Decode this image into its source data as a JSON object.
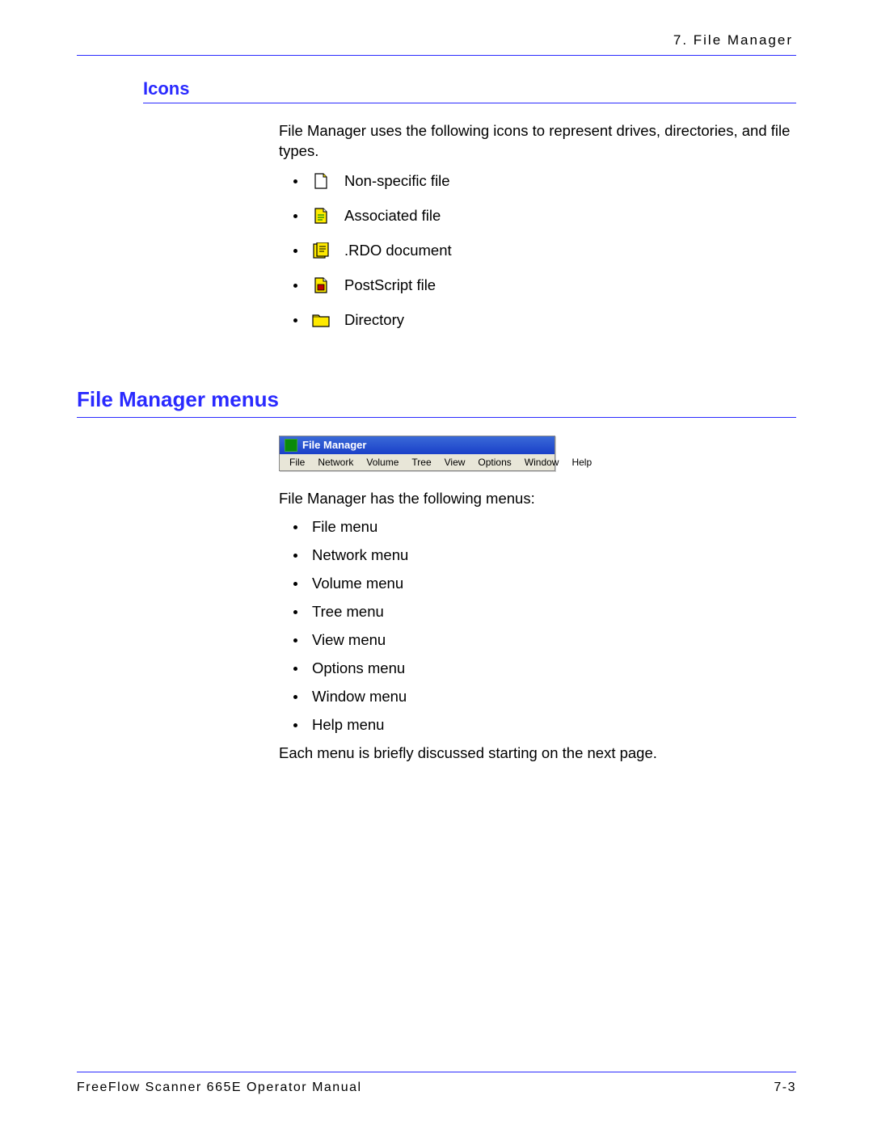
{
  "chapter_header": "7. File Manager",
  "section_icons": {
    "heading": "Icons",
    "intro": "File Manager uses the following icons to represent drives, directories, and file types.",
    "items": [
      {
        "label": "Non-specific file"
      },
      {
        "label": "Associated file"
      },
      {
        "label": ".RDO document"
      },
      {
        "label": "PostScript file"
      },
      {
        "label": "Directory"
      }
    ]
  },
  "section_menus": {
    "heading": "File Manager menus",
    "window_title": "File Manager",
    "menubar": [
      "File",
      "Network",
      "Volume",
      "Tree",
      "View",
      "Options",
      "Window",
      "Help"
    ],
    "intro": "File Manager has the following menus:",
    "items": [
      "File menu",
      "Network menu",
      "Volume menu",
      "Tree menu",
      "View menu",
      "Options menu",
      "Window menu",
      "Help menu"
    ],
    "outro": "Each menu is briefly discussed starting on the next page."
  },
  "footer": {
    "left": "FreeFlow Scanner 665E Operator Manual",
    "right": "7-3"
  }
}
